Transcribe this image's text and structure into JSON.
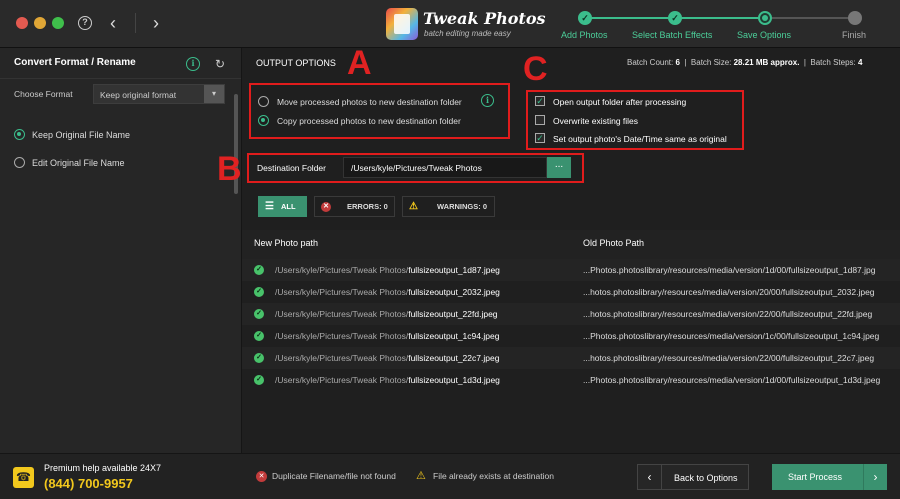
{
  "titlebar": {
    "app_name": "Tweak Photos",
    "tagline": "batch editing made easy",
    "help_glyph": "?",
    "steps": [
      {
        "label": "Add Photos",
        "state": "done"
      },
      {
        "label": "Select Batch Effects",
        "state": "done"
      },
      {
        "label": "Save Options",
        "state": "current"
      },
      {
        "label": "Finish",
        "state": "pending"
      }
    ]
  },
  "sidebar": {
    "title": "Convert Format / Rename",
    "choose_format_label": "Choose Format",
    "format_value": "Keep original format",
    "rename_options": [
      {
        "label": "Keep Original File Name",
        "selected": true
      },
      {
        "label": "Edit Original File Name",
        "selected": false
      }
    ]
  },
  "help": {
    "text": "Premium help available 24X7",
    "phone": "(844) 700-9957"
  },
  "output": {
    "title": "OUTPUT OPTIONS",
    "batch_count_label": "Batch Count:",
    "batch_count": "6",
    "batch_size_label": "Batch Size:",
    "batch_size": "28.21 MB approx.",
    "batch_steps_label": "Batch Steps:",
    "batch_steps": "4",
    "annotations": {
      "a": "A",
      "b": "B",
      "c": "C"
    },
    "move_copy": [
      {
        "label": "Move processed photos to new destination folder",
        "selected": false
      },
      {
        "label": "Copy processed photos to new destination folder",
        "selected": true
      }
    ],
    "checkboxes": [
      {
        "label": "Open output folder after processing",
        "checked": true
      },
      {
        "label": "Overwrite existing files",
        "checked": false
      },
      {
        "label": "Set output photo's Date/Time same as original",
        "checked": true
      }
    ],
    "destination_label": "Destination Folder",
    "destination_path": "/Users/kyle/Pictures/Tweak Photos",
    "browse_label": "...",
    "filters": {
      "all": "ALL",
      "errors": "ERRORS: 0",
      "warnings": "WARNINGS: 0"
    }
  },
  "table": {
    "col_new": "New Photo path",
    "col_old": "Old Photo Path",
    "rows": [
      {
        "dir": "/Users/kyle/Pictures/Tweak Photos/",
        "file": "fullsizeoutput_1d87.jpeg",
        "old": "...Photos.photoslibrary/resources/media/version/1d/00/fullsizeoutput_1d87.jpg"
      },
      {
        "dir": "/Users/kyle/Pictures/Tweak Photos/",
        "file": "fullsizeoutput_2032.jpeg",
        "old": "...hotos.photoslibrary/resources/media/version/20/00/fullsizeoutput_2032.jpeg"
      },
      {
        "dir": "/Users/kyle/Pictures/Tweak Photos/",
        "file": "fullsizeoutput_22fd.jpeg",
        "old": "...hotos.photoslibrary/resources/media/version/22/00/fullsizeoutput_22fd.jpeg"
      },
      {
        "dir": "/Users/kyle/Pictures/Tweak Photos/",
        "file": "fullsizeoutput_1c94.jpeg",
        "old": "...Photos.photoslibrary/resources/media/version/1c/00/fullsizeoutput_1c94.jpeg"
      },
      {
        "dir": "/Users/kyle/Pictures/Tweak Photos/",
        "file": "fullsizeoutput_22c7.jpeg",
        "old": "...hotos.photoslibrary/resources/media/version/22/00/fullsizeoutput_22c7.jpeg"
      },
      {
        "dir": "/Users/kyle/Pictures/Tweak Photos/",
        "file": "fullsizeoutput_1d3d.jpeg",
        "old": "...Photos.photoslibrary/resources/media/version/1d/00/fullsizeoutput_1d3d.jpeg"
      }
    ]
  },
  "footer": {
    "legend_error": "Duplicate Filename/file not found",
    "legend_warning": "File already exists at destination",
    "back_label": "Back to Options",
    "start_label": "Start Process"
  },
  "colors": {
    "accent": "#3bbd8c",
    "annotation": "#e01c1c",
    "phone": "#f2c81d"
  },
  "icons": [
    "help-icon",
    "back-arrow-icon",
    "forward-arrow-icon",
    "app-logo-icon",
    "info-icon",
    "refresh-icon",
    "dropdown-arrow-icon",
    "list-icon",
    "error-icon",
    "warning-icon",
    "check-icon",
    "phone-icon",
    "chevron-left-icon",
    "chevron-right-icon"
  ]
}
